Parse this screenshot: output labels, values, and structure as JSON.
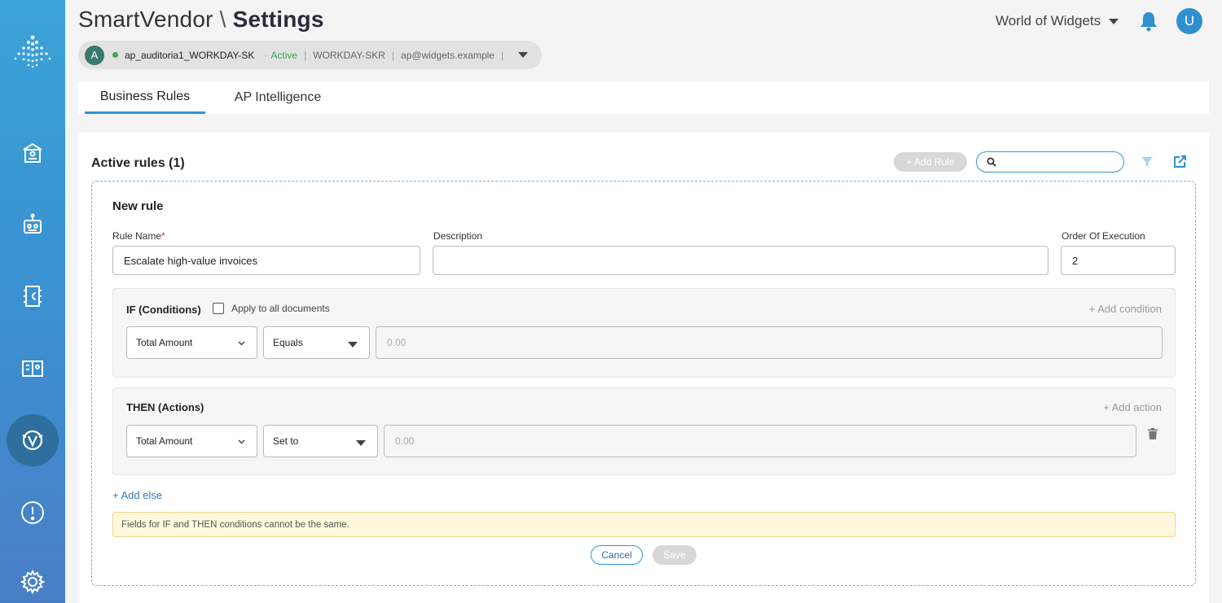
{
  "header": {
    "app_name": "SmartVendor",
    "separator": "\\",
    "page": "Settings",
    "org_name": "World of Widgets",
    "user_initial": "U"
  },
  "context": {
    "avatar_initial": "A",
    "name": "ap_auditoria1_WORKDAY-SK",
    "dot_sep": "·",
    "status": "Active",
    "sep": "|",
    "tenant": "WORKDAY-SKR",
    "email": "ap@widgets.example"
  },
  "tabs": [
    {
      "label": "Business Rules",
      "active": true
    },
    {
      "label": "AP Intelligence",
      "active": false
    }
  ],
  "rules": {
    "active_title": "Active rules (1)",
    "add_rule_label": "+ Add Rule",
    "search_value": ""
  },
  "new_rule": {
    "heading": "New rule",
    "rule_name_label": "Rule Name",
    "required_mark": "*",
    "rule_name_value": "Escalate high-value invoices",
    "description_label": "Description",
    "description_value": "",
    "order_label": "Order Of Execution",
    "order_value": "2",
    "if_block": {
      "title": "IF (Conditions)",
      "apply_all_label": "Apply to all documents",
      "add_condition": "+ Add condition",
      "field": "Total Amount",
      "operator": "Equals",
      "value_placeholder": "0.00"
    },
    "then_block": {
      "title": "THEN (Actions)",
      "add_action": "+ Add action",
      "field": "Total Amount",
      "operator": "Set to",
      "value_placeholder": "0.00"
    },
    "add_else": "+ Add else",
    "warning": "Fields for IF and THEN conditions cannot be the same.",
    "cancel_label": "Cancel",
    "save_label": "Save"
  },
  "colors": {
    "accent": "#3394cf",
    "active_status": "#37a857",
    "warning_bg": "#fff8dc"
  }
}
